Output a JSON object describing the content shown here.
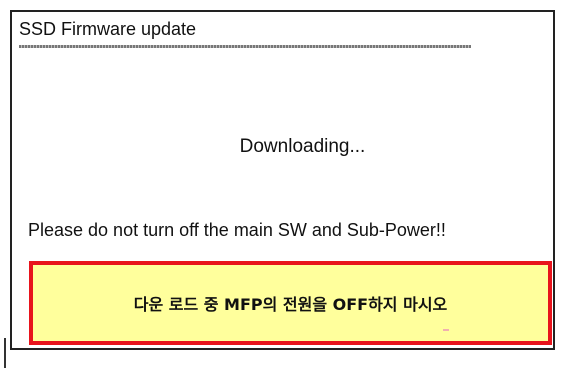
{
  "dialog": {
    "title": "SSD Firmware update",
    "status": "Downloading...",
    "warning": "Please do not turn off the main SW and Sub-Power!!",
    "notice": "다운 로드 중 MFP의 전원을 OFF하지 마시오"
  },
  "colors": {
    "notice_background": "#ffff9c",
    "notice_border": "#e8141c",
    "frame_border": "#222222"
  }
}
